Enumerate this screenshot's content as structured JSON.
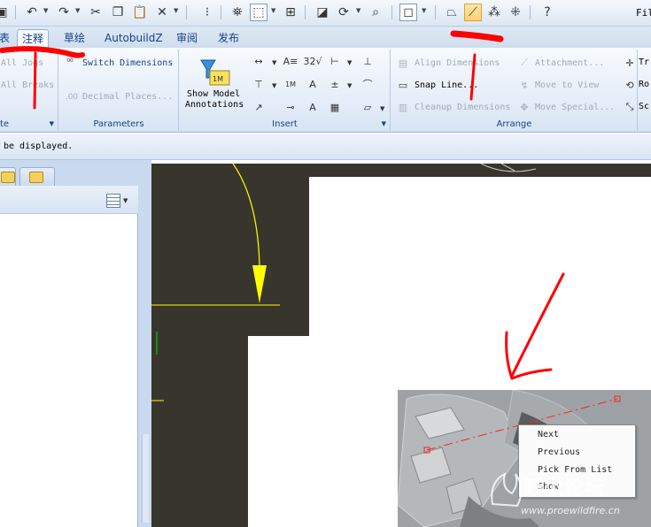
{
  "title_right": "Fil",
  "tabs": [
    "表",
    "注释",
    "草绘",
    "AutobuildZ",
    "审阅",
    "发布"
  ],
  "active_tab": "注释",
  "ribbon": {
    "groups": {
      "partial": "te",
      "parameters": "Parameters",
      "insert": "Insert",
      "arrange": "Arrange"
    },
    "partial_items": [
      "All Jogs",
      "All Breaks"
    ],
    "switch_dimensions": "Switch Dimensions",
    "decimal_places": "Decimal Places...",
    "show_model_annotations": [
      "Show Model",
      "Annotations"
    ],
    "insert_icons": [
      "dimension-icon",
      "ordinate-icon",
      "note-icon",
      "surface-finish-icon",
      "datum-icon",
      "gtol-icon",
      "balloon-icon",
      "symbol-icon"
    ],
    "insert_small_labels": [
      "32",
      "A",
      "1M",
      "A"
    ],
    "align_dimensions": "Align Dimensions",
    "snap_line": "Snap Line...",
    "cleanup_dimensions": "Cleanup Dimensions",
    "attachment": "Attachment...",
    "move_to_view": "Move to View",
    "move_special": "Move Special...",
    "right_cut": [
      "Tr",
      "Ro",
      "Sc"
    ]
  },
  "message": "be displayed.",
  "context_menu": [
    "Next",
    "Previous",
    "Pick From List",
    "Show"
  ],
  "watermark": {
    "cn": "野火论坛",
    "url": "www.proewildfire.cn"
  },
  "colors": {
    "annotation_red": "#ff0000",
    "canvas_bg": "#38352d",
    "sheet": "#ffffff",
    "yellow_annotation": "#ffff00",
    "green_line": "#00e000",
    "ribbon_text": "#15428b"
  }
}
